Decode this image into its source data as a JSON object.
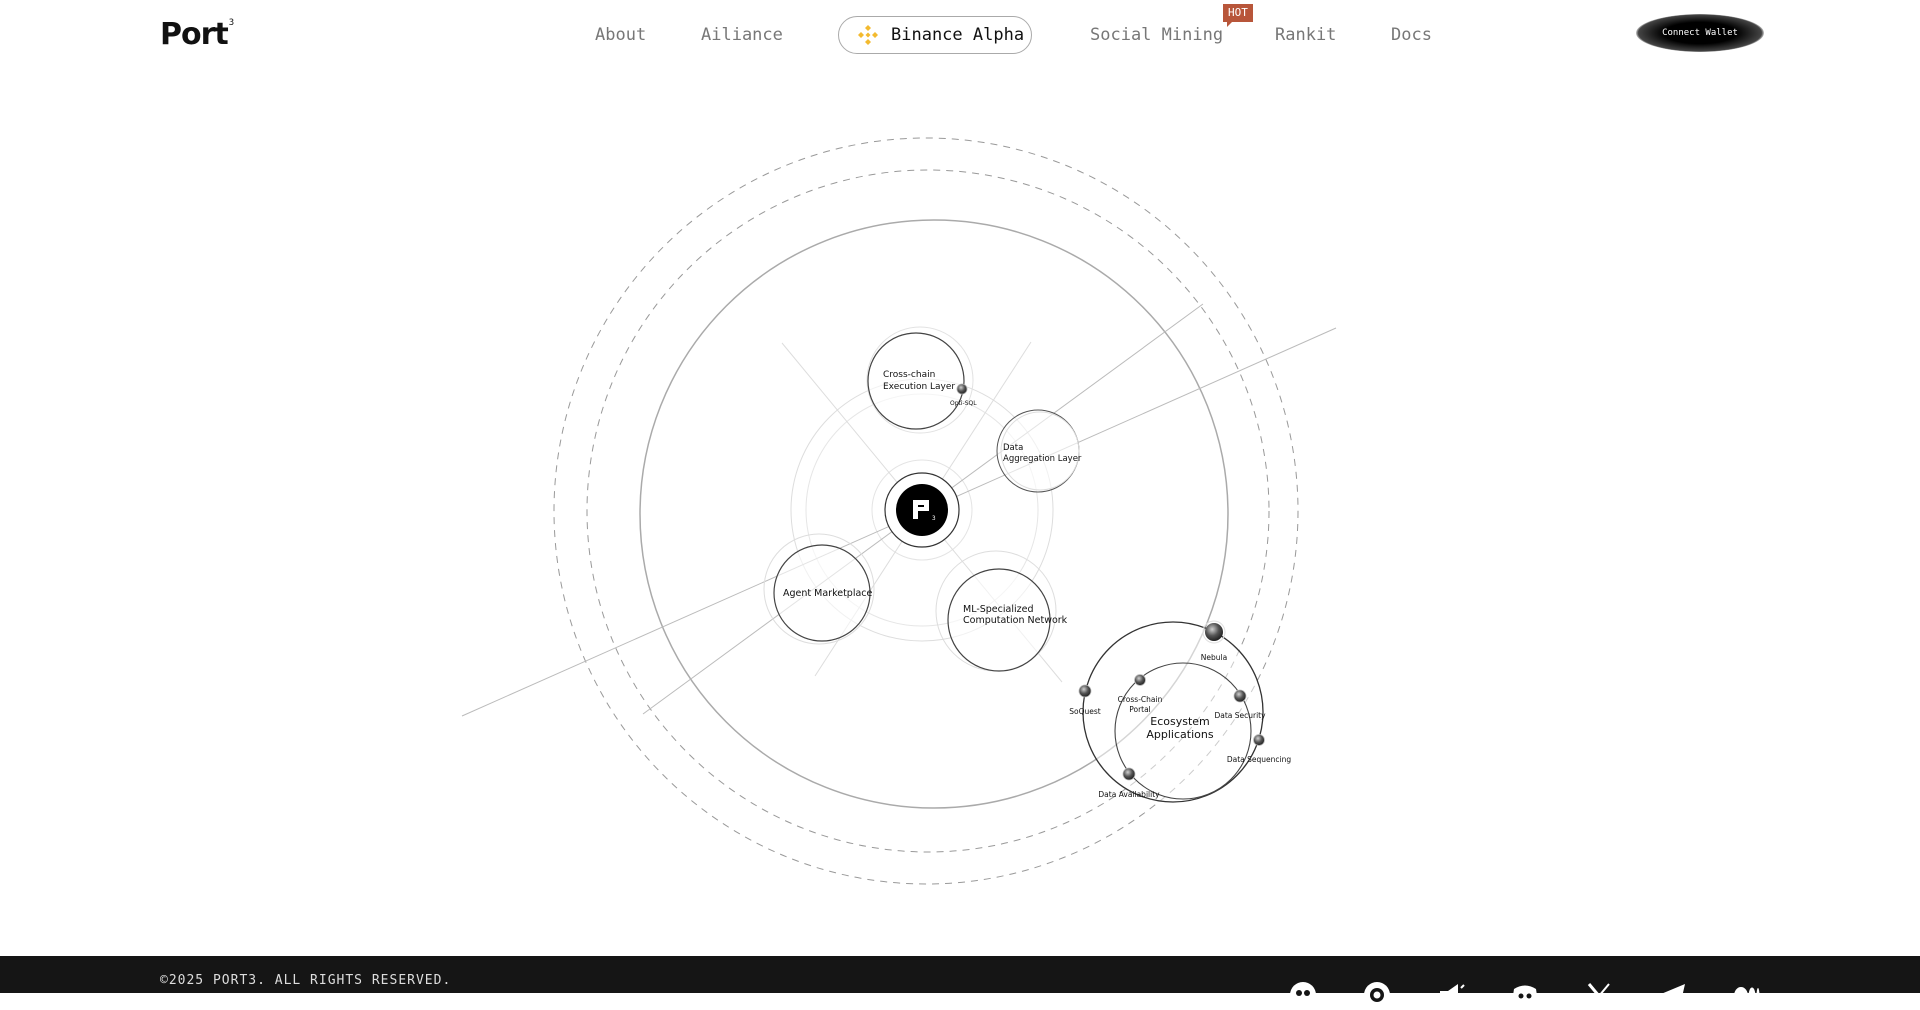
{
  "brand": {
    "name": "Port",
    "superscript": "3"
  },
  "nav": {
    "links": [
      {
        "label": "About"
      },
      {
        "label": "Ailiance"
      },
      {
        "label": "Binance Alpha"
      },
      {
        "label": "Social Mining",
        "badge": "HOT"
      },
      {
        "label": "Rankit"
      },
      {
        "label": "Docs"
      }
    ],
    "connect_wallet": "Connect Wallet"
  },
  "diagram": {
    "center_icon": "port3-logo-icon",
    "nodes": {
      "cross_chain": [
        "Cross-chain",
        "Execution Layer"
      ],
      "cross_chain_satellite": "Opti-SQL",
      "data_aggregation": [
        "Data",
        "Aggregation Layer"
      ],
      "agent_marketplace": "Agent Marketplace",
      "ml_network": [
        "ML-Specialized",
        "Computation Network"
      ],
      "ecosystem": [
        "Ecosystem",
        "Applications"
      ]
    },
    "ecosystem_satellites": [
      {
        "label": [
          "Nebula"
        ]
      },
      {
        "label": [
          "Cross-Chain",
          "Portal"
        ]
      },
      {
        "label": [
          "SoQuest"
        ]
      },
      {
        "label": [
          "Data Security"
        ]
      },
      {
        "label": [
          "Data Sequencing"
        ]
      },
      {
        "label": [
          "Data Availability"
        ]
      }
    ]
  },
  "footer": {
    "copyright": "©2025 PORT3. ALL RIGHTS RESERVED.",
    "social_icons": [
      "community-icon",
      "chat-icon",
      "megaphone-icon",
      "discord-icon",
      "x-icon",
      "telegram-icon",
      "medium-icon"
    ]
  },
  "colors": {
    "hot_badge": "#b8563a",
    "footer_bg": "#151515",
    "binance_gold": "#F3BA2F"
  }
}
